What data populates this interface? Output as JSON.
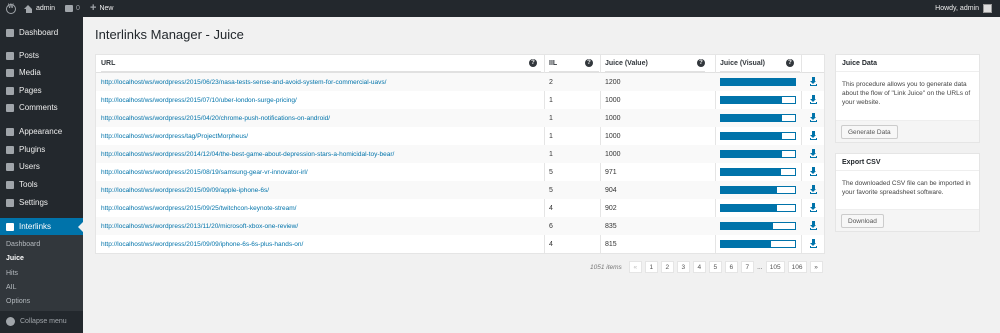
{
  "adminbar": {
    "site_name": "admin",
    "comments_count": "0",
    "new_label": "New",
    "howdy": "Howdy, admin"
  },
  "sidebar": {
    "items": [
      {
        "label": "Dashboard",
        "icon": "dashboard-icon"
      },
      {
        "label": "Posts",
        "icon": "pin-icon"
      },
      {
        "label": "Media",
        "icon": "media-icon"
      },
      {
        "label": "Pages",
        "icon": "pages-icon"
      },
      {
        "label": "Comments",
        "icon": "comments-icon"
      },
      {
        "label": "Appearance",
        "icon": "appearance-icon"
      },
      {
        "label": "Plugins",
        "icon": "plugins-icon"
      },
      {
        "label": "Users",
        "icon": "users-icon"
      },
      {
        "label": "Tools",
        "icon": "tools-icon"
      },
      {
        "label": "Settings",
        "icon": "settings-icon"
      },
      {
        "label": "Interlinks",
        "icon": "link-icon"
      }
    ],
    "submenu": [
      "Dashboard",
      "Juice",
      "Hits",
      "AIL",
      "Options"
    ],
    "collapse_label": "Collapse menu"
  },
  "page": {
    "title": "Interlinks Manager - Juice"
  },
  "table": {
    "headers": {
      "url": "URL",
      "iil": "IIL",
      "juice_value": "Juice (Value)",
      "juice_visual": "Juice (Visual)"
    },
    "rows": [
      {
        "url": "http://localhost/ws/wordpress/2015/06/23/nasa-tests-sense-and-avoid-system-for-commercial-uavs/",
        "iil": "2",
        "juice": "1200",
        "fill": 1.0
      },
      {
        "url": "http://localhost/ws/wordpress/2015/07/10/uber-london-surge-pricing/",
        "iil": "1",
        "juice": "1000",
        "fill": 0.83
      },
      {
        "url": "http://localhost/ws/wordpress/2015/04/20/chrome-push-notifications-on-android/",
        "iil": "1",
        "juice": "1000",
        "fill": 0.83
      },
      {
        "url": "http://localhost/ws/wordpress/tag/ProjectMorpheus/",
        "iil": "1",
        "juice": "1000",
        "fill": 0.83
      },
      {
        "url": "http://localhost/ws/wordpress/2014/12/04/the-best-game-about-depression-stars-a-homicidal-toy-bear/",
        "iil": "1",
        "juice": "1000",
        "fill": 0.83
      },
      {
        "url": "http://localhost/ws/wordpress/2015/08/19/samsung-gear-vr-innovator-irl/",
        "iil": "5",
        "juice": "971",
        "fill": 0.81
      },
      {
        "url": "http://localhost/ws/wordpress/2015/09/09/apple-iphone-6s/",
        "iil": "5",
        "juice": "904",
        "fill": 0.75
      },
      {
        "url": "http://localhost/ws/wordpress/2015/09/25/twitchcon-keynote-stream/",
        "iil": "4",
        "juice": "902",
        "fill": 0.75
      },
      {
        "url": "http://localhost/ws/wordpress/2013/11/20/microsoft-xbox-one-review/",
        "iil": "6",
        "juice": "835",
        "fill": 0.7
      },
      {
        "url": "http://localhost/ws/wordpress/2015/09/09/iphone-6s-6s-plus-hands-on/",
        "iil": "4",
        "juice": "815",
        "fill": 0.68
      }
    ]
  },
  "pagination": {
    "count": "1051 items",
    "prev": "«",
    "pages": [
      "1",
      "2",
      "3",
      "4",
      "5",
      "6",
      "7"
    ],
    "dots": "...",
    "last_pages": [
      "105",
      "106"
    ],
    "next": "»"
  },
  "panels": {
    "juice_data": {
      "title": "Juice Data",
      "text": "This procedure allows you to generate data about the flow of \"Link Juice\" on the URLs of your website.",
      "button": "Generate Data"
    },
    "export_csv": {
      "title": "Export CSV",
      "text": "The downloaded CSV file can be imported in your favorite spreadsheet software.",
      "button": "Download"
    }
  },
  "colors": {
    "accent": "#0073aa",
    "sidebar_bg": "#23282d"
  }
}
